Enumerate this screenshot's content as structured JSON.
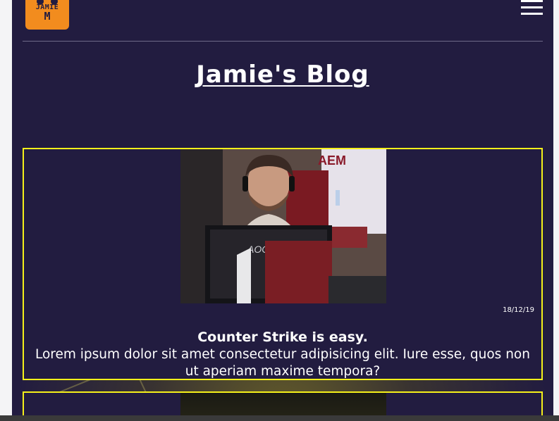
{
  "header": {
    "logo_line1": "JAMIE",
    "logo_line2": "M"
  },
  "page": {
    "title": "Jamie's Blog"
  },
  "posts": [
    {
      "image": "gamer-at-aoc-monitor-photo",
      "date": "18/12/19",
      "title": "Counter Strike is easy.",
      "body": "Lorem ipsum dolor sit amet consectetur adipisicing elit. Iure esse, quos non ut aperiam maxime tempora?"
    },
    {
      "image": "dark-photo"
    }
  ],
  "photo_text": {
    "sponsor": "AEM",
    "monitor_brand": "AOC"
  },
  "colors": {
    "background": "#221c40",
    "card_border": "#f5f01a",
    "logo": "#f28c1e"
  }
}
